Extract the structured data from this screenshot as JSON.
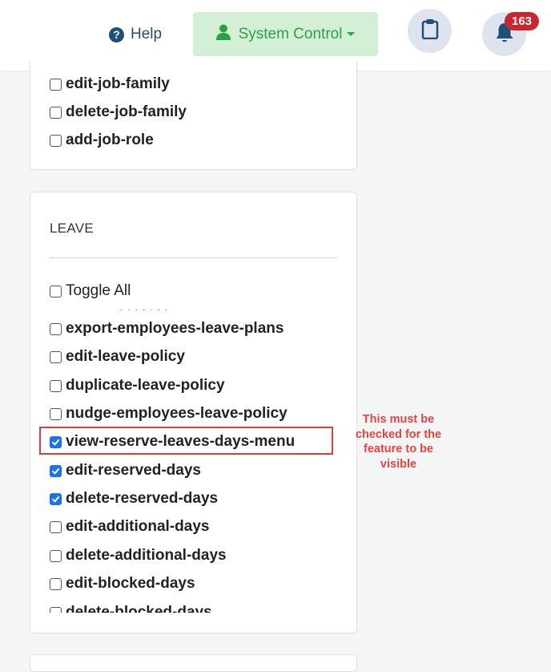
{
  "header": {
    "help_label": "Help",
    "system_control_label": "System Control",
    "notification_count": "163",
    "icons": {
      "help": "question-circle-icon",
      "user": "user-icon",
      "clipboard": "clipboard-icon",
      "bell": "bell-icon",
      "caret": "caret-down-icon"
    },
    "colors": {
      "system_control_bg": "#d3f0d6",
      "system_control_text": "#2f9e44",
      "badge": "#c9262f",
      "help_text": "#24506e"
    }
  },
  "job_section": {
    "items": [
      {
        "label": "edit-job-family",
        "checked": false
      },
      {
        "label": "delete-job-family",
        "checked": false
      },
      {
        "label": "add-job-role",
        "checked": false
      }
    ]
  },
  "leave_section": {
    "title": "LEAVE",
    "toggle_all_label": "Toggle All",
    "items": [
      {
        "label": "export-employees-leave-plans",
        "checked": false
      },
      {
        "label": "edit-leave-policy",
        "checked": false
      },
      {
        "label": "duplicate-leave-policy",
        "checked": false
      },
      {
        "label": "nudge-employees-leave-policy",
        "checked": false
      },
      {
        "label": "view-reserve-leaves-days-menu",
        "checked": true
      },
      {
        "label": "edit-reserved-days",
        "checked": true
      },
      {
        "label": "delete-reserved-days",
        "checked": true
      },
      {
        "label": "edit-additional-days",
        "checked": false
      },
      {
        "label": "delete-additional-days",
        "checked": false
      },
      {
        "label": "edit-blocked-days",
        "checked": false
      },
      {
        "label": "delete-blocked-days",
        "checked": false
      }
    ]
  },
  "annotation": {
    "text": "This must be checked for the feature to be visible",
    "color": "#e8433c"
  }
}
